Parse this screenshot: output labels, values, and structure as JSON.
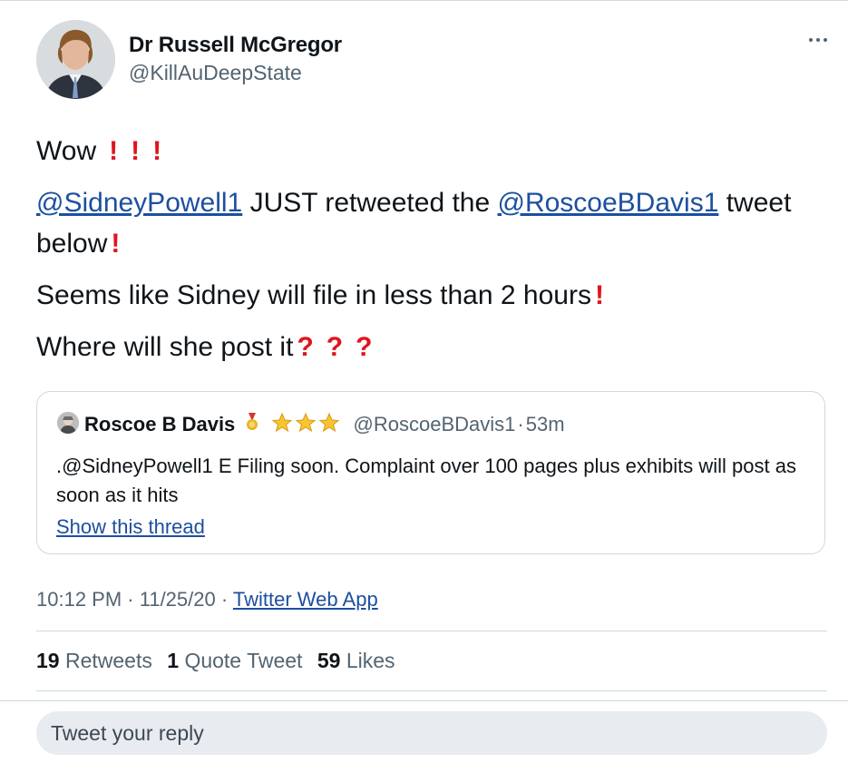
{
  "author": {
    "name": "Dr Russell McGregor",
    "handle": "@KillAuDeepState"
  },
  "tweet": {
    "line1": "Wow",
    "line2_mention1": "@SidneyPowell1",
    "line2_middle": " JUST retweeted the ",
    "line2_mention2": "@RoscoeBDavis1",
    "line2_end": " tweet below",
    "line3": "Seems like Sidney will file in less than 2 hours",
    "line4": "Where will she post it"
  },
  "quoted": {
    "name": "Roscoe B Davis",
    "handle": "@RoscoeBDavis1",
    "separator": "·",
    "time": "53m",
    "text": ".@SidneyPowell1 E Filing soon. Complaint over 100 pages plus exhibits will post as soon as it hits",
    "show_thread": "Show this thread"
  },
  "meta": {
    "time": "10:12 PM",
    "sep1": " · ",
    "date": "11/25/20",
    "sep2": " · ",
    "source": "Twitter Web App"
  },
  "stats": {
    "retweets_count": "19",
    "retweets_label": "Retweets",
    "quotes_count": "1",
    "quotes_label": "Quote Tweet",
    "likes_count": "59",
    "likes_label": "Likes"
  },
  "reply": {
    "placeholder": "Tweet your reply"
  },
  "colors": {
    "link": "#1d4fa0",
    "emphasis": "#e0141c",
    "muted": "#536471"
  }
}
